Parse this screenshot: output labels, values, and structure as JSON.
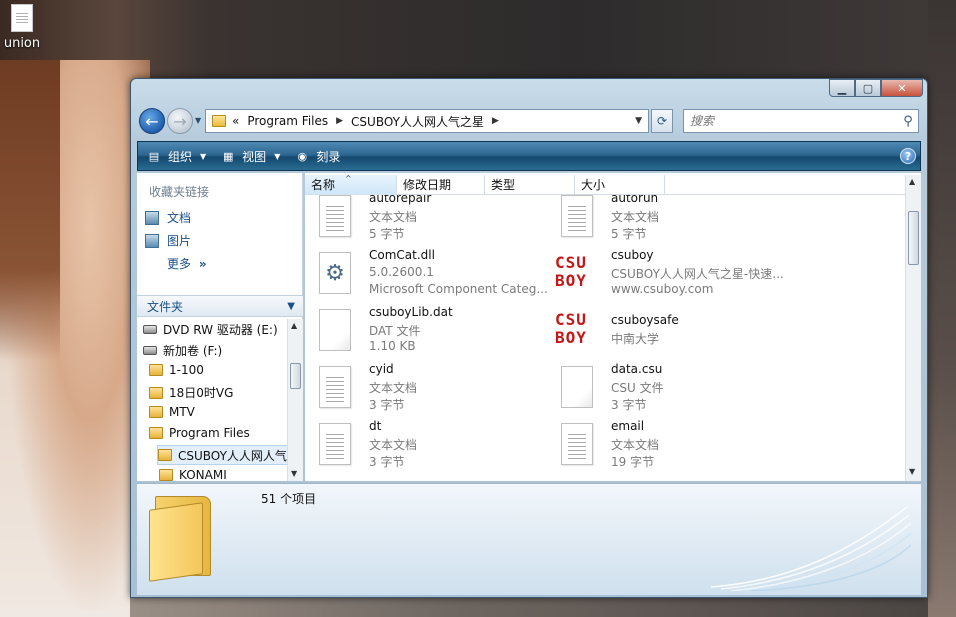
{
  "desktop": {
    "icon_label": "union"
  },
  "window": {
    "title_buttons": {
      "minimize": "▁",
      "maximize": "▢",
      "close": "✕"
    }
  },
  "nav": {
    "address": {
      "prefix": "«",
      "crumbs": [
        "Program Files",
        "CSUBOY人人网人气之星"
      ]
    },
    "search_placeholder": "搜索"
  },
  "commands": {
    "organize": "组织",
    "views": "视图",
    "burn": "刻录",
    "help": "?"
  },
  "navpane": {
    "favorites_title": "收藏夹链接",
    "favorites": [
      {
        "label": "文档"
      },
      {
        "label": "图片"
      }
    ],
    "more": "更多",
    "more_glyph": "»",
    "folders_header": "文件夹",
    "tree": [
      {
        "label": "DVD RW 驱动器 (E:)",
        "type": "drive"
      },
      {
        "label": "新加卷 (F:)",
        "type": "drive"
      },
      {
        "label": "1-100",
        "type": "folder"
      },
      {
        "label": "18日0时VG",
        "type": "folder"
      },
      {
        "label": "MTV",
        "type": "folder"
      },
      {
        "label": "Program Files",
        "type": "folder"
      },
      {
        "label": "CSUBOY人人网人气",
        "type": "folder",
        "selected": true
      },
      {
        "label": "KONAMI",
        "type": "folder"
      }
    ]
  },
  "columns": [
    "名称",
    "修改日期",
    "类型",
    "大小"
  ],
  "files": [
    {
      "name": "autorepair",
      "type": "文本文档",
      "size": "5 字节",
      "icon": "text-doc-icon"
    },
    {
      "name": "autorun",
      "type": "文本文档",
      "size": "5 字节",
      "icon": "text-doc-icon"
    },
    {
      "name": "ComCat.dll",
      "type": "5.0.2600.1",
      "size": "Microsoft Component Categ...",
      "icon": "dll-gear-icon"
    },
    {
      "name": "csuboy",
      "type": "CSUBOY人人网人气之星-快速...",
      "size": "www.csuboy.com",
      "icon": "csuboy-logo-icon"
    },
    {
      "name": "csuboyLib.dat",
      "type": "DAT 文件",
      "size": "1.10 KB",
      "icon": "blank-doc-icon"
    },
    {
      "name": "csuboysafe",
      "type": "中南大学",
      "size": "",
      "icon": "csuboy-logo-icon"
    },
    {
      "name": "cyid",
      "type": "文本文档",
      "size": "3 字节",
      "icon": "text-doc-icon"
    },
    {
      "name": "data.csu",
      "type": "CSU 文件",
      "size": "3 字节",
      "icon": "blank-doc-icon"
    },
    {
      "name": "dt",
      "type": "文本文档",
      "size": "3 字节",
      "icon": "text-doc-icon"
    },
    {
      "name": "email",
      "type": "文本文档",
      "size": "19 字节",
      "icon": "text-doc-icon"
    }
  ],
  "logo_text": {
    "line1": "CSU",
    "line2": "BOY"
  },
  "details": {
    "count_text": "51 个项目"
  }
}
